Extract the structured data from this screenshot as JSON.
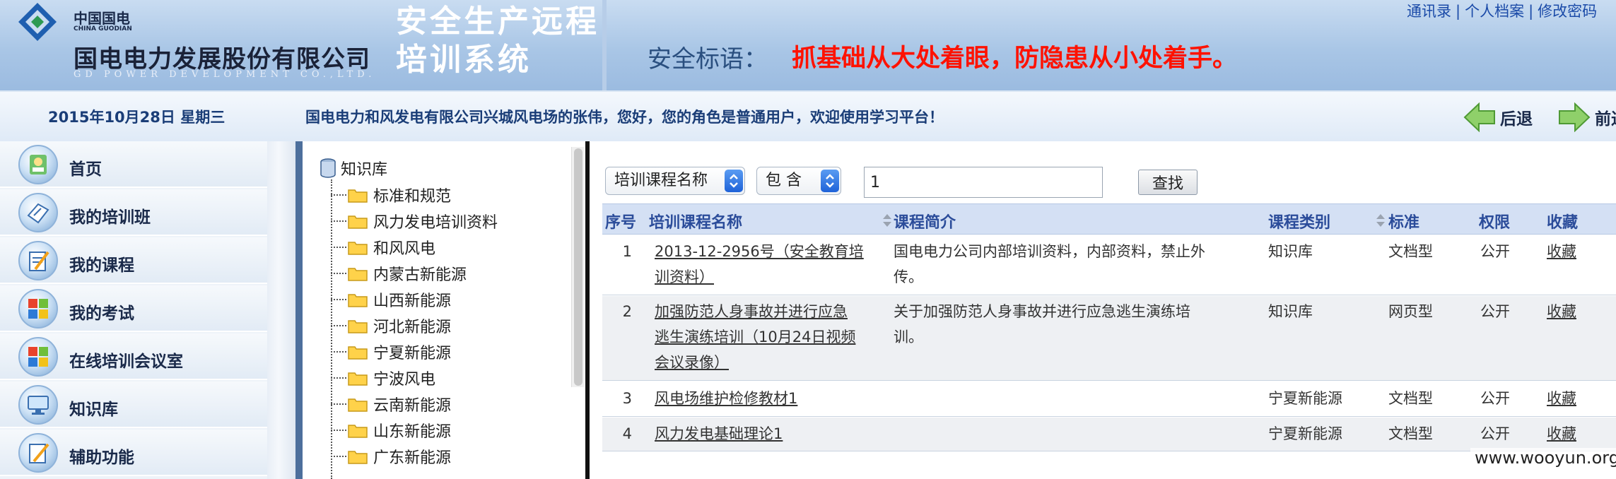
{
  "header": {
    "logo_small_cn": "中国国电",
    "logo_small_en": "CHINA GUODIAN",
    "company_name": "国电电力发展股份有限公司",
    "company_en": "GD POWER DEVELOPMENT CO.,LTD.",
    "system_title": "安全生产远程培训系统",
    "slogan_label": "安全标语：",
    "slogan_text": "抓基础从大处着眼，防隐患从小处着手。",
    "top_links": [
      "通讯录",
      "个人档案",
      "修改密码"
    ],
    "colors": {
      "slogan": "#ff1200",
      "header_bg": "#a9c6e6"
    }
  },
  "infobar": {
    "date": "2015年10月28日  星期三",
    "welcome": "国电电力和风发电有限公司兴城风电场的张伟，您好，您的角色是普通用户，欢迎使用学习平台！",
    "back_label": "后退",
    "forward_label": "前进"
  },
  "sidebar": {
    "items": [
      {
        "label": "首页",
        "icon": "home-icon"
      },
      {
        "label": "我的培训班",
        "icon": "training-class-icon"
      },
      {
        "label": "我的课程",
        "icon": "course-icon"
      },
      {
        "label": "我的考试",
        "icon": "exam-icon"
      },
      {
        "label": "在线培训会议室",
        "icon": "meeting-room-icon"
      },
      {
        "label": "知识库",
        "icon": "knowledge-icon"
      },
      {
        "label": "辅助功能",
        "icon": "tools-icon"
      }
    ]
  },
  "tree": {
    "root": "知识库",
    "items": [
      "标准和规范",
      "风力发电培训资料",
      "和风风电",
      "内蒙古新能源",
      "山西新能源",
      "河北新能源",
      "宁夏新能源",
      "宁波风电",
      "云南新能源",
      "山东新能源",
      "广东新能源"
    ]
  },
  "search": {
    "field": "培训课程名称",
    "operator": "包 含",
    "value": "1",
    "button": "查找"
  },
  "table": {
    "headers": {
      "no": "序号",
      "name": "培训课程名称",
      "intro": "课程简介",
      "category": "课程类别",
      "standard": "标准",
      "permission": "权限",
      "favorite": "收藏"
    },
    "rows": [
      {
        "no": "1",
        "name_lines": [
          "2013-12-2956号（安全教育培",
          "训资料）"
        ],
        "intro_lines": [
          "国电电力公司内部培训资料，内部资料，禁止外",
          "传。"
        ],
        "category": "知识库",
        "standard": "文档型",
        "permission": "公开",
        "favorite": "收藏"
      },
      {
        "no": "2",
        "name_lines": [
          "加强防范人身事故并进行应急",
          "逃生演练培训（10月24日视频",
          "会议录像）"
        ],
        "intro_lines": [
          "关于加强防范人身事故并进行应急逃生演练培",
          "训。"
        ],
        "category": "知识库",
        "standard": "网页型",
        "permission": "公开",
        "favorite": "收藏"
      },
      {
        "no": "3",
        "name_lines": [
          "风电场维护检修教材1"
        ],
        "intro_lines": [],
        "category": "宁夏新能源",
        "standard": "文档型",
        "permission": "公开",
        "favorite": "收藏"
      },
      {
        "no": "4",
        "name_lines": [
          "风力发电基础理论1"
        ],
        "intro_lines": [],
        "category": "宁夏新能源",
        "standard": "文档型",
        "permission": "公开",
        "favorite": "收藏"
      }
    ]
  },
  "watermark": "www.wooyun.org"
}
